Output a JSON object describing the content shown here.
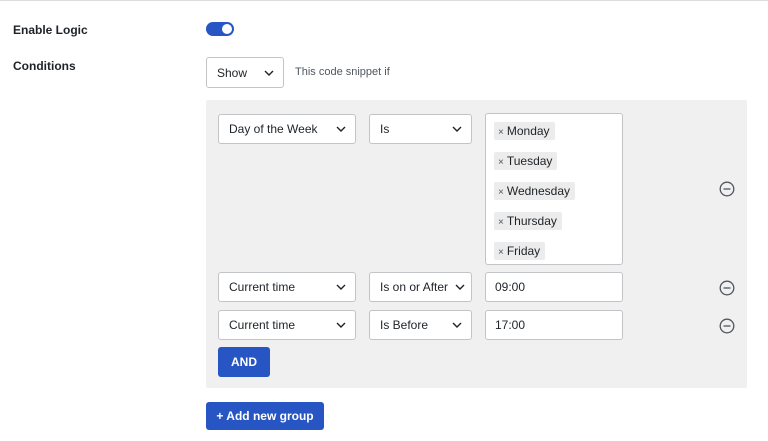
{
  "labels": {
    "enable_logic": "Enable Logic",
    "conditions": "Conditions"
  },
  "enable_logic_toggle": {
    "on": true
  },
  "show_select": {
    "value": "Show"
  },
  "hint": "This code snippet if",
  "rows": [
    {
      "field": "Day of the Week",
      "operator": "Is",
      "values": [
        "Monday",
        "Tuesday",
        "Wednesday",
        "Thursday",
        "Friday"
      ]
    },
    {
      "field": "Current time",
      "operator": "Is on or After",
      "value": "09:00"
    },
    {
      "field": "Current time",
      "operator": "Is Before",
      "value": "17:00"
    }
  ],
  "buttons": {
    "and": "AND",
    "add_group": "+ Add new group"
  },
  "icons": {
    "remove": "minus-circle-icon",
    "chevron": "chevron-down-icon",
    "tag_remove": "x-icon"
  },
  "colors": {
    "accent": "#2755c4",
    "group_bg": "#f0f0f1"
  }
}
